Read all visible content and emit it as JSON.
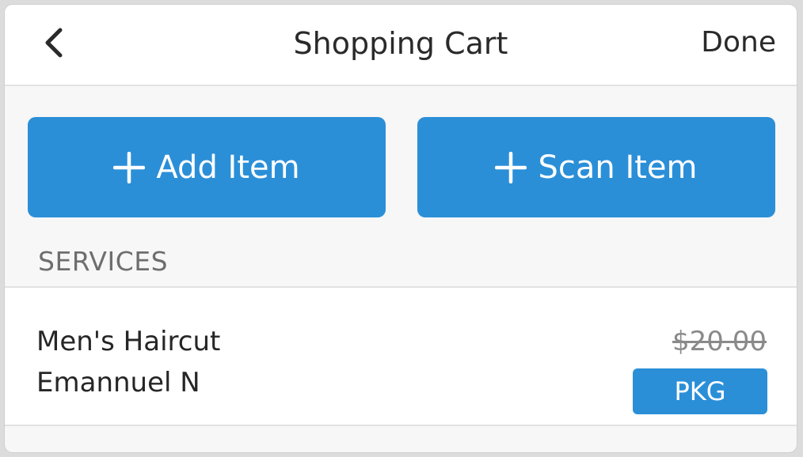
{
  "colors": {
    "accent": "#2b8fd8",
    "background": "#f7f7f7",
    "surface": "#ffffff",
    "text": "#2a2a2a",
    "muted": "#6e6e6e"
  },
  "header": {
    "back_icon": "chevron-left-icon",
    "title": "Shopping Cart",
    "done_label": "Done"
  },
  "actions": {
    "add_item": {
      "icon": "plus-icon",
      "label": "Add Item"
    },
    "scan_item": {
      "icon": "plus-icon",
      "label": "Scan Item"
    }
  },
  "cart": {
    "section_title": "SERVICES",
    "items": [
      {
        "name": "Men's Haircut",
        "staff": "Emannuel N",
        "original_price": "$20.00",
        "badge": "PKG"
      }
    ]
  }
}
